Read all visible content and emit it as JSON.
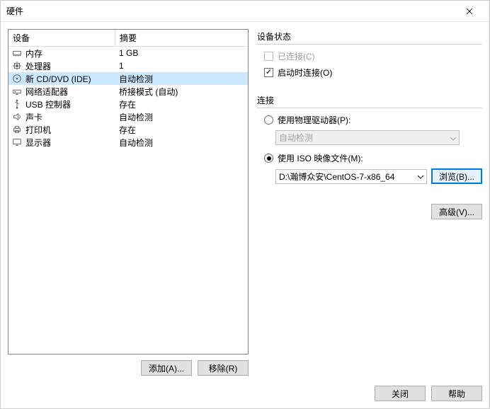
{
  "titlebar": {
    "title": "硬件"
  },
  "table": {
    "header_device": "设备",
    "header_summary": "摘要",
    "rows": [
      {
        "icon": "memory",
        "label": "内存",
        "summary": "1 GB",
        "selected": false
      },
      {
        "icon": "cpu",
        "label": "处理器",
        "summary": "1",
        "selected": false
      },
      {
        "icon": "disc",
        "label": "新 CD/DVD (IDE)",
        "summary": "自动检测",
        "selected": true
      },
      {
        "icon": "network",
        "label": "网络适配器",
        "summary": "桥接模式 (自动)",
        "selected": false
      },
      {
        "icon": "usb",
        "label": "USB 控制器",
        "summary": "存在",
        "selected": false
      },
      {
        "icon": "sound",
        "label": "声卡",
        "summary": "自动检测",
        "selected": false
      },
      {
        "icon": "printer",
        "label": "打印机",
        "summary": "存在",
        "selected": false
      },
      {
        "icon": "display",
        "label": "显示器",
        "summary": "自动检测",
        "selected": false
      }
    ]
  },
  "buttons": {
    "add": "添加(A)...",
    "remove": "移除(R)",
    "browse": "浏览(B)...",
    "advanced": "高级(V)...",
    "close": "关闭",
    "help": "帮助"
  },
  "device_status": {
    "title": "设备状态",
    "connected_label": "已连接(C)",
    "connect_at_poweron_label": "启动时连接(O)"
  },
  "connection": {
    "title": "连接",
    "use_physical_label": "使用物理驱动器(P):",
    "physical_value": "自动检测",
    "use_iso_label": "使用 ISO 映像文件(M):",
    "iso_path": "D:\\瀚博众安\\CentOS-7-x86_64"
  }
}
